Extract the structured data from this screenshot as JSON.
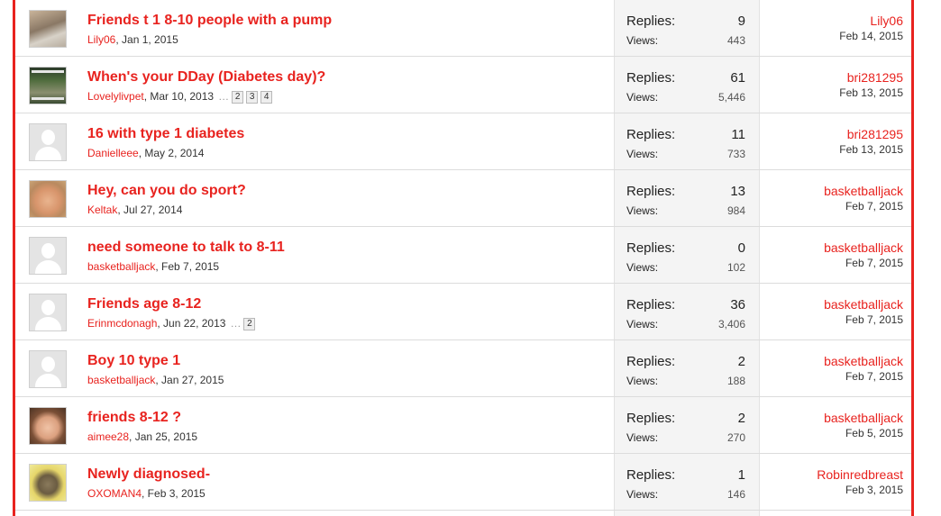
{
  "labels": {
    "replies": "Replies:",
    "views": "Views:"
  },
  "colors": {
    "accent": "#e8231f",
    "stats_bg": "#f4f4f4",
    "divider": "#dcdcdc"
  },
  "threads": [
    {
      "title": "Friends t 1 8-10 people with a pump",
      "author": "Lily06",
      "date": ", Jan 1, 2015",
      "pages": [],
      "replies": "9",
      "views": "443",
      "last_user": "Lily06",
      "last_date": "Feb 14, 2015",
      "avatar": "dog-photo"
    },
    {
      "title": "When's your DDay (Diabetes day)?",
      "author": "Lovelylivpet",
      "date": ", Mar 10, 2013",
      "pages": [
        "2",
        "3",
        "4"
      ],
      "replies": "61",
      "views": "5,446",
      "last_user": "bri281295",
      "last_date": "Feb 13, 2015",
      "avatar": "meme-photo"
    },
    {
      "title": "16 with type 1 diabetes",
      "author": "Danielleee",
      "date": ", May 2, 2014",
      "pages": [],
      "replies": "11",
      "views": "733",
      "last_user": "bri281295",
      "last_date": "Feb 13, 2015",
      "avatar": "default-avatar"
    },
    {
      "title": "Hey, can you do sport?",
      "author": "Keltak",
      "date": ", Jul 27, 2014",
      "pages": [],
      "replies": "13",
      "views": "984",
      "last_user": "basketballjack",
      "last_date": "Feb 7, 2015",
      "avatar": "face-photo"
    },
    {
      "title": "need someone to talk to 8-11",
      "author": "basketballjack",
      "date": ", Feb 7, 2015",
      "pages": [],
      "replies": "0",
      "views": "102",
      "last_user": "basketballjack",
      "last_date": "Feb 7, 2015",
      "avatar": "default-avatar"
    },
    {
      "title": "Friends age 8-12",
      "author": "Erinmcdonagh",
      "date": ", Jun 22, 2013",
      "pages": [
        "2"
      ],
      "replies": "36",
      "views": "3,406",
      "last_user": "basketballjack",
      "last_date": "Feb 7, 2015",
      "avatar": "default-avatar"
    },
    {
      "title": "Boy 10 type 1",
      "author": "basketballjack",
      "date": ", Jan 27, 2015",
      "pages": [],
      "replies": "2",
      "views": "188",
      "last_user": "basketballjack",
      "last_date": "Feb 7, 2015",
      "avatar": "default-avatar"
    },
    {
      "title": "friends 8-12 ?",
      "author": "aimee28",
      "date": ", Jan 25, 2015",
      "pages": [],
      "replies": "2",
      "views": "270",
      "last_user": "basketballjack",
      "last_date": "Feb 5, 2015",
      "avatar": "kid-photo"
    },
    {
      "title": "Newly diagnosed-",
      "author": "OXOMAN4",
      "date": ", Feb 3, 2015",
      "pages": [],
      "replies": "1",
      "views": "146",
      "last_user": "Robinredbreast",
      "last_date": "Feb 3, 2015",
      "avatar": "cat-photo"
    }
  ]
}
